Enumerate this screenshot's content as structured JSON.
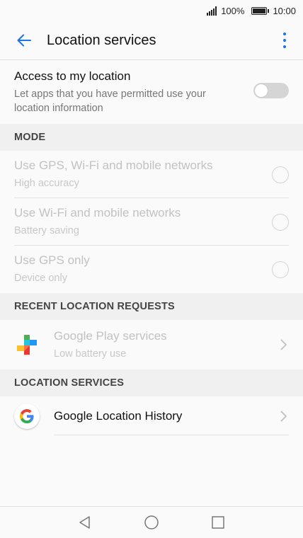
{
  "status_bar": {
    "battery": "100%",
    "time": "10:00",
    "battery_level": 1.0
  },
  "header": {
    "title": "Location services",
    "back_icon": "arrow-back-icon",
    "more_icon": "more-vert-icon",
    "accent_color": "#1a73e8"
  },
  "access": {
    "title": "Access to my location",
    "description": "Let apps that you have permitted use your location information",
    "enabled": false
  },
  "mode": {
    "header": "MODE",
    "options": [
      {
        "title": "Use GPS, Wi-Fi and mobile networks",
        "subtitle": "High accuracy",
        "selected": false
      },
      {
        "title": "Use Wi-Fi and mobile networks",
        "subtitle": "Battery saving",
        "selected": false
      },
      {
        "title": "Use GPS only",
        "subtitle": "Device only",
        "selected": false
      }
    ]
  },
  "recent": {
    "header": "RECENT LOCATION REQUESTS",
    "items": [
      {
        "name": "Google Play services",
        "usage": "Low battery use",
        "icon": "google-play-services-icon"
      }
    ]
  },
  "location_services": {
    "header": "LOCATION SERVICES",
    "items": [
      {
        "name": "Google Location History",
        "icon": "google-g-icon"
      }
    ]
  },
  "nav": {
    "back_icon": "nav-back-icon",
    "home_icon": "nav-home-icon",
    "recents_icon": "nav-recents-icon"
  }
}
